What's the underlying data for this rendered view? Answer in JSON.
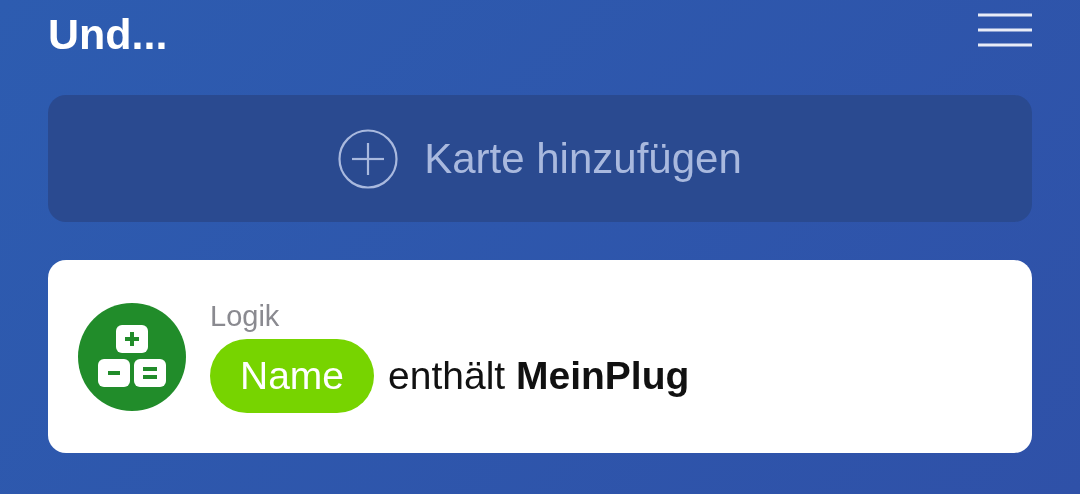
{
  "header": {
    "title": "Und..."
  },
  "add_card_button": {
    "label": "Karte hinzufügen"
  },
  "cards": [
    {
      "kind": "logic",
      "category": "Logik",
      "variable": "Name",
      "condition": "enthält **MeinPlug**"
    }
  ]
}
